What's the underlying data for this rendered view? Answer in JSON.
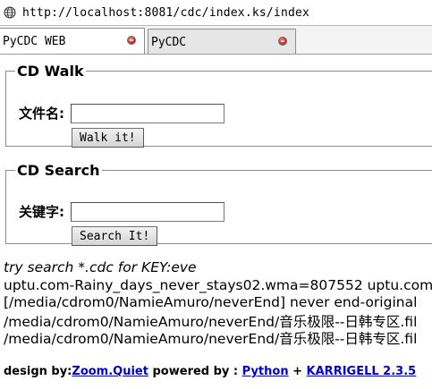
{
  "browser": {
    "url": "http://localhost:8081/cdc/index.ks/index",
    "tabs": [
      {
        "label": "PyCDC WEB",
        "active": true
      },
      {
        "label": "PyCDC",
        "active": false
      }
    ],
    "close_icon_color": "#d83030"
  },
  "cd_walk": {
    "legend": "CD Walk",
    "field_label": "文件名:",
    "input_value": "",
    "button_label": "Walk it!"
  },
  "cd_search": {
    "legend": "CD Search",
    "field_label": "关键字:",
    "input_value": "",
    "button_label": "Search It!"
  },
  "results": {
    "hint": "try search *.cdc for KEY:eve",
    "lines": [
      "uptu.com-Rainy_days_never_stays02.wma=807552 uptu.com-",
      "[/media/cdrom0/NamieAmuro/neverEnd] never end-original",
      "/media/cdrom0/NamieAmuro/neverEnd/音乐极限--日韩专区.fil",
      "/media/cdrom0/NamieAmuro/neverEnd/音乐极限--日韩专区.fil"
    ]
  },
  "footer": {
    "design_by_label": "design by:",
    "design_by_link": "Zoom.Quiet",
    "powered_by_label": "powered by :",
    "python_link": "Python",
    "plus": "+",
    "karrigell_link": "KARRIGELL 2.3.5",
    "link_color": "#0000cc"
  }
}
